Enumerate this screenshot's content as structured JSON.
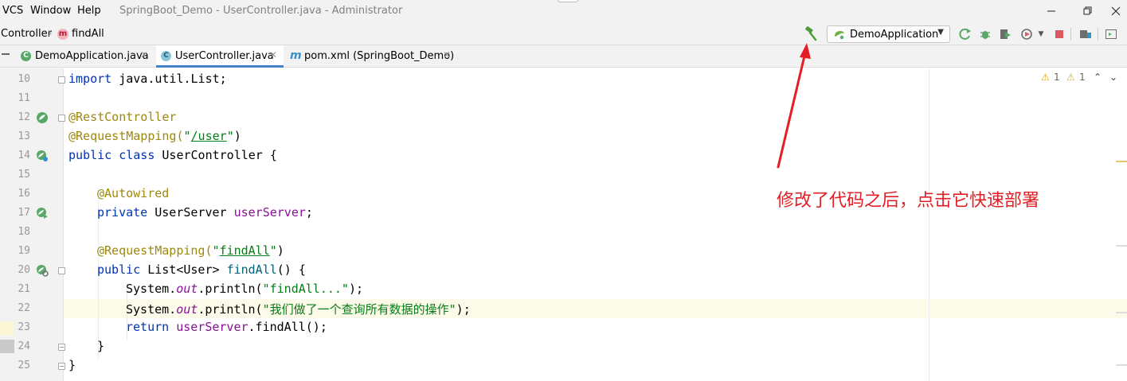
{
  "menu": {
    "items": [
      "VCS",
      "Window",
      "Help"
    ]
  },
  "window": {
    "title": "SpringBoot_Demo - UserController.java - Administrator"
  },
  "breadcrumb": {
    "class_name": "Controller",
    "method_icon_letter": "m",
    "method": "findAll"
  },
  "toolbar": {
    "run_config": "DemoApplication"
  },
  "tabs": [
    {
      "label": "DemoApplication.java",
      "icon_letter": "C",
      "active": false
    },
    {
      "label": "UserController.java",
      "icon_letter": "C",
      "active": true
    },
    {
      "label": "pom.xml (SpringBoot_Demo)",
      "icon_letter": "m",
      "active": false
    }
  ],
  "inspections": {
    "warnings": "1",
    "weak_warnings": "1"
  },
  "editor": {
    "lines": [
      {
        "n": "10"
      },
      {
        "n": "11"
      },
      {
        "n": "12"
      },
      {
        "n": "13"
      },
      {
        "n": "14"
      },
      {
        "n": "15"
      },
      {
        "n": "16"
      },
      {
        "n": "17"
      },
      {
        "n": "18"
      },
      {
        "n": "19"
      },
      {
        "n": "20"
      },
      {
        "n": "21"
      },
      {
        "n": "22"
      },
      {
        "n": "23"
      },
      {
        "n": "24"
      },
      {
        "n": "25"
      }
    ],
    "code": {
      "l10_kw": "import",
      "l10_rest": " java.util.List;",
      "l12": "@RestController",
      "l13_ann": "@RequestMapping(",
      "l13_q1": "\"",
      "l13_path": "/user",
      "l13_q2": "\"",
      "l13_end": ")",
      "l14_kw": "public class",
      "l14_rest": " UserController {",
      "l16": "@Autowired",
      "l17_kw": "private",
      "l17_type": " UserServer ",
      "l17_field": "userServer",
      "l17_end": ";",
      "l19_ann": "@RequestMapping(",
      "l19_q1": "\"",
      "l19_path": "findAll",
      "l19_q2": "\"",
      "l19_end": ")",
      "l20_kw": "public",
      "l20_type": " List<User> ",
      "l20_fn": "findAll",
      "l20_end": "() {",
      "l21_a": "System.",
      "l21_out": "out",
      "l21_b": ".println(",
      "l21_str": "\"findAll...\"",
      "l21_end": ");",
      "l22_a": "System.",
      "l22_out": "out",
      "l22_b": ".println(",
      "l22_str": "\"我们做了一个查询所有数据的操作\"",
      "l22_end": ");",
      "l23_kw": "return",
      "l23_field": " userServer",
      "l23_end": ".findAll();",
      "l24": "}",
      "l25": "}"
    }
  },
  "annotation": {
    "text": "修改了代码之后，点击它快速部署",
    "color": "#e31e24"
  },
  "colors": {
    "keyword": "#0033b3",
    "annotation": "#9e880d",
    "string": "#067d17",
    "field": "#871094",
    "accent": "#4083c9"
  }
}
